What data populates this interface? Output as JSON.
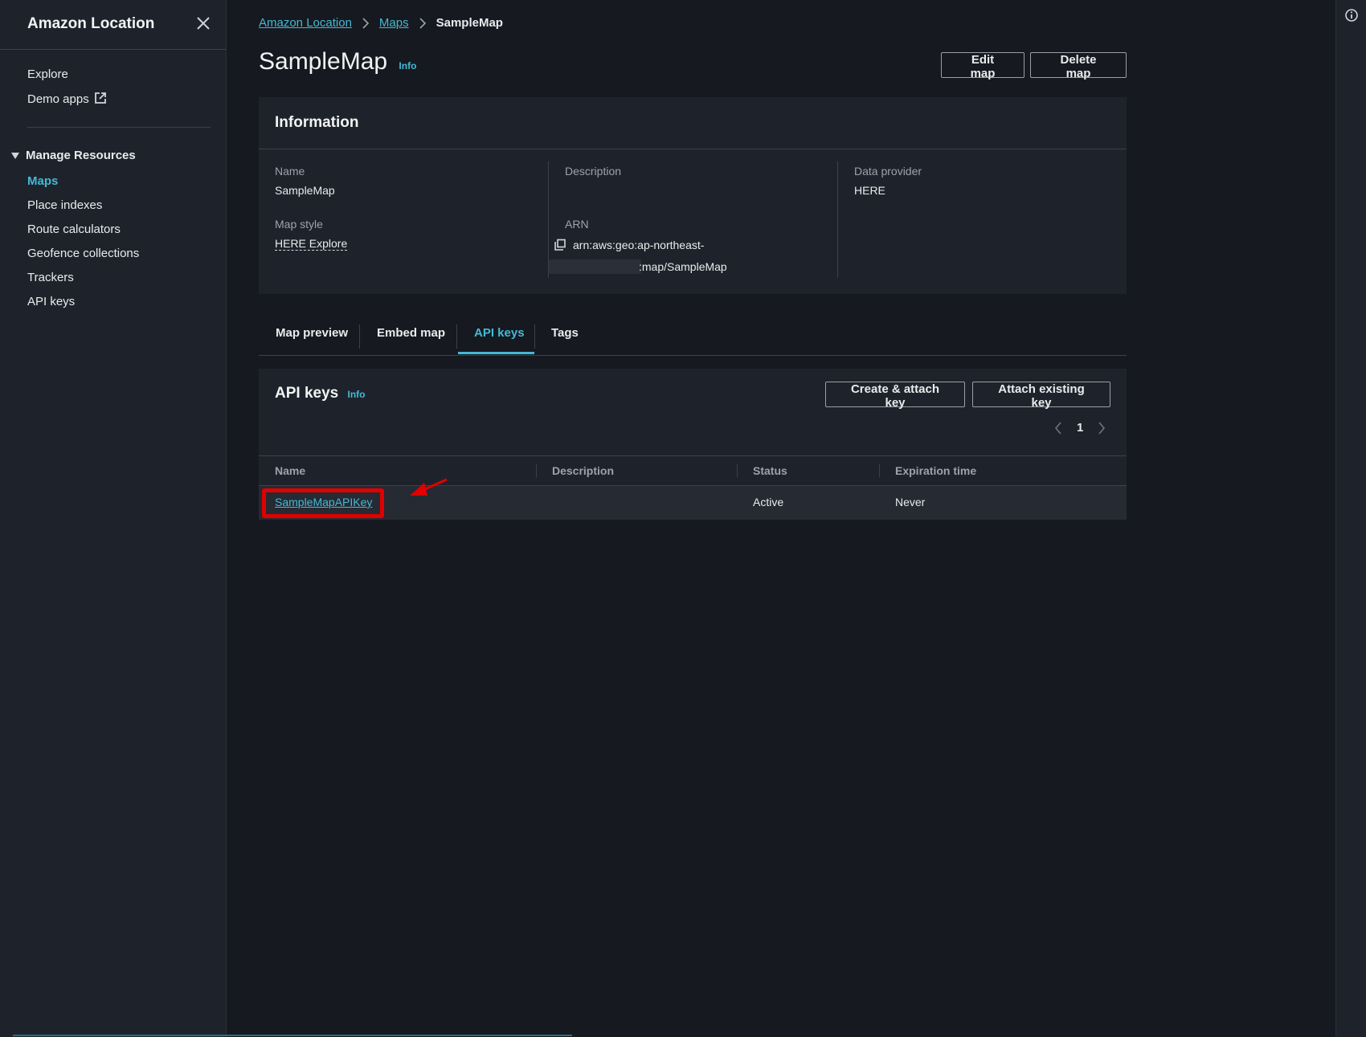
{
  "sidebar": {
    "title": "Amazon Location",
    "explore": "Explore",
    "demo_apps": "Demo apps",
    "section": "Manage Resources",
    "items": [
      {
        "label": "Maps",
        "active": true
      },
      {
        "label": "Place indexes"
      },
      {
        "label": "Route calculators"
      },
      {
        "label": "Geofence collections"
      },
      {
        "label": "Trackers"
      },
      {
        "label": "API keys"
      }
    ]
  },
  "breadcrumb": {
    "items": [
      "Amazon Location",
      "Maps"
    ],
    "current": "SampleMap"
  },
  "page": {
    "title": "SampleMap",
    "info": "Info",
    "edit_button": "Edit map",
    "delete_button": "Delete map"
  },
  "information": {
    "heading": "Information",
    "name_label": "Name",
    "name_value": "SampleMap",
    "map_style_label": "Map style",
    "map_style_value": "HERE Explore",
    "description_label": "Description",
    "arn_label": "ARN",
    "arn_line1": "arn:aws:geo:ap-northeast-",
    "arn_line2": ":map/SampleMap",
    "provider_label": "Data provider",
    "provider_value": "HERE"
  },
  "tabs": [
    {
      "label": "Map preview"
    },
    {
      "label": "Embed map"
    },
    {
      "label": "API keys",
      "active": true
    },
    {
      "label": "Tags"
    }
  ],
  "api_keys": {
    "title": "API keys",
    "info": "Info",
    "create_button": "Create & attach key",
    "attach_button": "Attach existing key",
    "page_number": "1",
    "columns": [
      "Name",
      "Description",
      "Status",
      "Expiration time"
    ],
    "rows": [
      {
        "name": "SampleMapAPIKey",
        "description": "",
        "status": "Active",
        "expiration": "Never"
      }
    ]
  },
  "colors": {
    "accent": "#44b9d6",
    "highlight": "#e00000",
    "background": "#16191f",
    "panel": "#1e232b"
  }
}
